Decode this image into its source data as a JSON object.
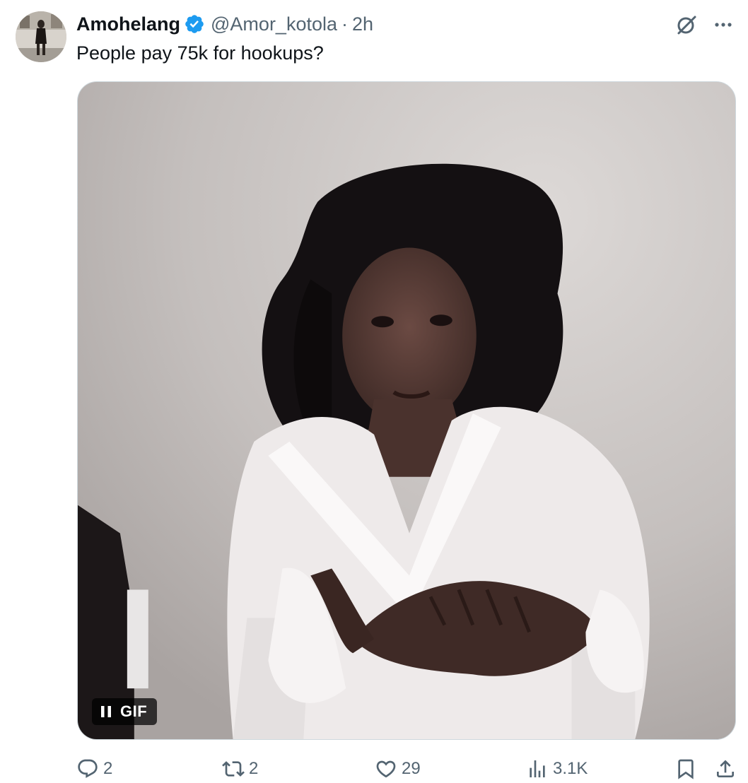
{
  "author": {
    "display_name": "Amohelang",
    "handle": "@Amor_kotola",
    "separator": "·",
    "timestamp": "2h",
    "verified": true
  },
  "tweet": {
    "text": "People pay 75k for hookups?"
  },
  "media": {
    "type": "gif",
    "badge_label": "GIF",
    "playing": true
  },
  "actions": {
    "replies": "2",
    "reposts": "2",
    "likes": "29",
    "views": "3.1K"
  },
  "icons": {
    "verified": "verified-badge-icon",
    "grok": "grok-icon",
    "more": "more-icon",
    "pause": "pause-icon",
    "reply": "reply-icon",
    "repost": "repost-icon",
    "like": "heart-icon",
    "views": "views-icon",
    "bookmark": "bookmark-icon",
    "share": "share-icon"
  },
  "colors": {
    "text_primary": "#0f1419",
    "text_secondary": "#536471",
    "verified_blue": "#1d9bf0",
    "border": "#cfd9de"
  }
}
